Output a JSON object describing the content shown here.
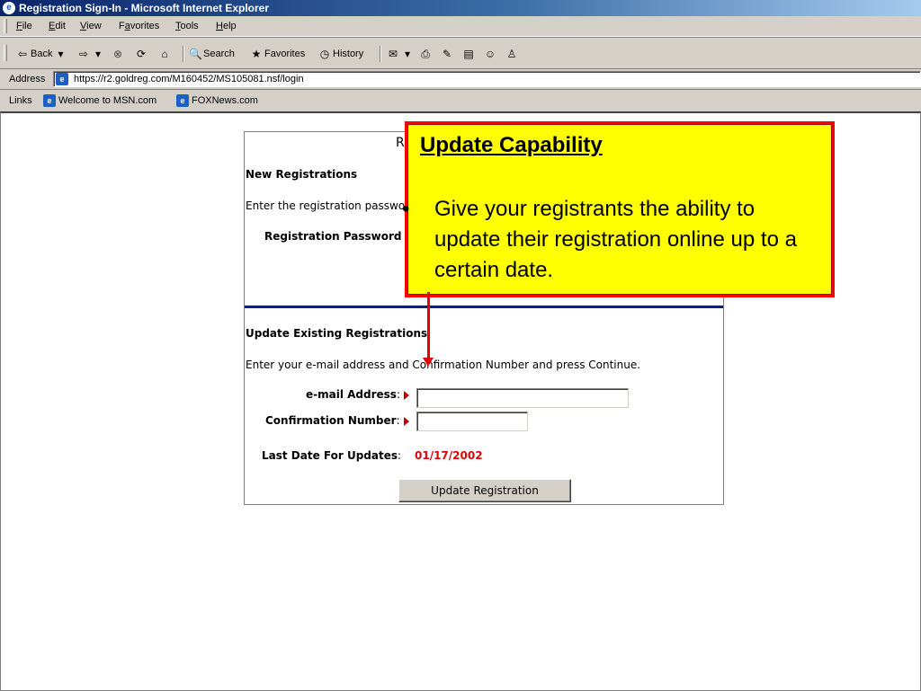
{
  "window": {
    "title": "Registration Sign-In - Microsoft Internet Explorer"
  },
  "menu": [
    {
      "label": "File",
      "u": "F"
    },
    {
      "label": "Edit",
      "u": "E"
    },
    {
      "label": "View",
      "u": "V"
    },
    {
      "label": "Favorites",
      "u": "a"
    },
    {
      "label": "Tools",
      "u": "T"
    },
    {
      "label": "Help",
      "u": "H"
    }
  ],
  "toolbar": {
    "back_label": "Back",
    "search_label": "Search",
    "favorites_label": "Favorites",
    "history_label": "History"
  },
  "address": {
    "label": "Address",
    "url": "https://r2.goldreg.com/M160452/MS105081.nsf/login"
  },
  "links": {
    "label": "Links",
    "items": [
      "Welcome to MSN.com",
      "FOXNews.com"
    ]
  },
  "form": {
    "heading_fragment": "R",
    "new_reg_heading": "New Registrations",
    "new_reg_instruction": "Enter the registration passwo",
    "password_label": "Registration Password",
    "update_heading": "Update Existing Registrations",
    "update_instruction": "Enter your e-mail address and Confirmation Number and press Continue.",
    "email_label": "e-mail Address",
    "confirmation_label": "Confirmation Number",
    "last_date_label": "Last Date For Updates",
    "last_date_value": "01/17/2002",
    "update_button": "Update Registration"
  },
  "callout": {
    "title": "Update Capability",
    "bullet": "•",
    "body": "Give your registrants the ability to update their registration online up to a certain date."
  },
  "colors": {
    "callout_fill": "#ffff00",
    "callout_border": "#ff0000",
    "date_value": "#e00000",
    "divider": "#0a246a"
  }
}
